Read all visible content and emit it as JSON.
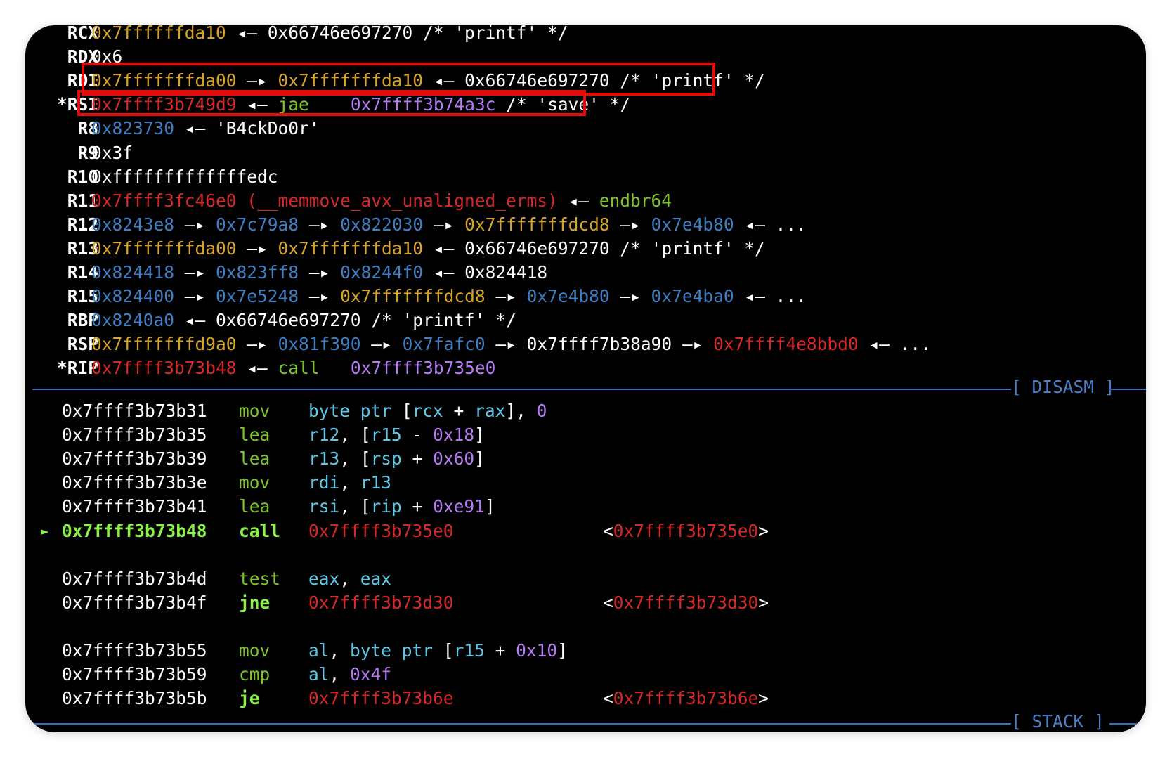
{
  "registers": [
    {
      "name": "RCX",
      "tokens": [
        {
          "t": "0x7ffffffda10",
          "c": "y"
        },
        {
          "t": " ◂— ",
          "c": "w"
        },
        {
          "t": "0x66746e697270 /* 'printf' */",
          "c": "w"
        }
      ]
    },
    {
      "name": "RDX",
      "tokens": [
        {
          "t": "0x6",
          "c": "w"
        }
      ]
    },
    {
      "name": "RDI",
      "tokens": [
        {
          "t": "0x7fffffffda00",
          "c": "y"
        },
        {
          "t": " —▸ ",
          "c": "w"
        },
        {
          "t": "0x7fffffffda10",
          "c": "y"
        },
        {
          "t": " ◂— ",
          "c": "w"
        },
        {
          "t": "0x66746e697270 /* 'printf' */",
          "c": "w"
        }
      ]
    },
    {
      "name": "*RSI",
      "tokens": [
        {
          "t": "0x7ffff3b749d9",
          "c": "r"
        },
        {
          "t": " ◂— ",
          "c": "w"
        },
        {
          "t": "jae",
          "c": "g"
        },
        {
          "t": "    ",
          "c": "w"
        },
        {
          "t": "0x7ffff3b74a3c",
          "c": "p"
        },
        {
          "t": " /* 'save' */",
          "c": "w"
        }
      ]
    },
    {
      "name": "R8",
      "tokens": [
        {
          "t": "0x823730",
          "c": "b"
        },
        {
          "t": " ◂— ",
          "c": "w"
        },
        {
          "t": "'B4ckDo0r'",
          "c": "w"
        }
      ]
    },
    {
      "name": "R9",
      "tokens": [
        {
          "t": "0x3f",
          "c": "w"
        }
      ]
    },
    {
      "name": "R10",
      "tokens": [
        {
          "t": "0xfffffffffffffedc",
          "c": "w"
        }
      ]
    },
    {
      "name": "R11",
      "tokens": [
        {
          "t": "0x7ffff3fc46e0 (__memmove_avx_unaligned_erms)",
          "c": "r"
        },
        {
          "t": " ◂— ",
          "c": "w"
        },
        {
          "t": "endbr64",
          "c": "g"
        }
      ]
    },
    {
      "name": "R12",
      "tokens": [
        {
          "t": "0x8243e8",
          "c": "b"
        },
        {
          "t": " —▸ ",
          "c": "w"
        },
        {
          "t": "0x7c79a8",
          "c": "b"
        },
        {
          "t": " —▸ ",
          "c": "w"
        },
        {
          "t": "0x822030",
          "c": "b"
        },
        {
          "t": " —▸ ",
          "c": "w"
        },
        {
          "t": "0x7fffffffdcd8",
          "c": "y"
        },
        {
          "t": " —▸ ",
          "c": "w"
        },
        {
          "t": "0x7e4b80",
          "c": "b"
        },
        {
          "t": " ◂— ...",
          "c": "w"
        }
      ]
    },
    {
      "name": "R13",
      "tokens": [
        {
          "t": "0x7fffffffda00",
          "c": "y"
        },
        {
          "t": " —▸ ",
          "c": "w"
        },
        {
          "t": "0x7fffffffda10",
          "c": "y"
        },
        {
          "t": " ◂— ",
          "c": "w"
        },
        {
          "t": "0x66746e697270 /* 'printf' */",
          "c": "w"
        }
      ]
    },
    {
      "name": "R14",
      "tokens": [
        {
          "t": "0x824418",
          "c": "b"
        },
        {
          "t": " —▸ ",
          "c": "w"
        },
        {
          "t": "0x823ff8",
          "c": "b"
        },
        {
          "t": " —▸ ",
          "c": "w"
        },
        {
          "t": "0x8244f0",
          "c": "b"
        },
        {
          "t": " ◂— ",
          "c": "w"
        },
        {
          "t": "0x824418",
          "c": "w"
        }
      ]
    },
    {
      "name": "R15",
      "tokens": [
        {
          "t": "0x824400",
          "c": "b"
        },
        {
          "t": " —▸ ",
          "c": "w"
        },
        {
          "t": "0x7e5248",
          "c": "b"
        },
        {
          "t": " —▸ ",
          "c": "w"
        },
        {
          "t": "0x7fffffffdcd8",
          "c": "y"
        },
        {
          "t": " —▸ ",
          "c": "w"
        },
        {
          "t": "0x7e4b80",
          "c": "b"
        },
        {
          "t": " —▸ ",
          "c": "w"
        },
        {
          "t": "0x7e4ba0",
          "c": "b"
        },
        {
          "t": " ◂— ...",
          "c": "w"
        }
      ]
    },
    {
      "name": "RBP",
      "tokens": [
        {
          "t": "0x8240a0",
          "c": "b"
        },
        {
          "t": " ◂— ",
          "c": "w"
        },
        {
          "t": "0x66746e697270 /* 'printf' */",
          "c": "w"
        }
      ]
    },
    {
      "name": "RSP",
      "tokens": [
        {
          "t": "0x7fffffffd9a0",
          "c": "y"
        },
        {
          "t": " —▸ ",
          "c": "w"
        },
        {
          "t": "0x81f390",
          "c": "b"
        },
        {
          "t": " —▸ ",
          "c": "w"
        },
        {
          "t": "0x7fafc0",
          "c": "b"
        },
        {
          "t": " —▸ ",
          "c": "w"
        },
        {
          "t": "0x7ffff7b38a90",
          "c": "w"
        },
        {
          "t": " —▸ ",
          "c": "w"
        },
        {
          "t": "0x7ffff4e8bbd0",
          "c": "r"
        },
        {
          "t": " ◂— ...",
          "c": "w"
        }
      ]
    },
    {
      "name": "*RIP",
      "tokens": [
        {
          "t": "0x7ffff3b73b48",
          "c": "r"
        },
        {
          "t": " ◂— ",
          "c": "w"
        },
        {
          "t": "call",
          "c": "g"
        },
        {
          "t": "   ",
          "c": "w"
        },
        {
          "t": "0x7ffff3b735e0",
          "c": "p"
        }
      ]
    }
  ],
  "disasm_label": "[ DISASM ]",
  "stack_label": "[ STACK ]",
  "current_marker": "►",
  "disasm": [
    {
      "addr": "0x7ffff3b73b31",
      "op": "mov",
      "ops": [
        {
          "t": "byte ptr",
          "c": "c"
        },
        {
          "t": " [",
          "c": "w"
        },
        {
          "t": "rcx",
          "c": "c"
        },
        {
          "t": " + ",
          "c": "w"
        },
        {
          "t": "rax",
          "c": "c"
        },
        {
          "t": "], ",
          "c": "w"
        },
        {
          "t": "0",
          "c": "p"
        }
      ],
      "target": "",
      "gap_after": false,
      "current": false
    },
    {
      "addr": "0x7ffff3b73b35",
      "op": "lea",
      "ops": [
        {
          "t": "r12",
          "c": "c"
        },
        {
          "t": ", [",
          "c": "w"
        },
        {
          "t": "r15",
          "c": "c"
        },
        {
          "t": " - ",
          "c": "w"
        },
        {
          "t": "0x18",
          "c": "p"
        },
        {
          "t": "]",
          "c": "w"
        }
      ],
      "target": "",
      "gap_after": false,
      "current": false
    },
    {
      "addr": "0x7ffff3b73b39",
      "op": "lea",
      "ops": [
        {
          "t": "r13",
          "c": "c"
        },
        {
          "t": ", [",
          "c": "w"
        },
        {
          "t": "rsp",
          "c": "c"
        },
        {
          "t": " + ",
          "c": "w"
        },
        {
          "t": "0x60",
          "c": "p"
        },
        {
          "t": "]",
          "c": "w"
        }
      ],
      "target": "",
      "gap_after": false,
      "current": false
    },
    {
      "addr": "0x7ffff3b73b3e",
      "op": "mov",
      "ops": [
        {
          "t": "rdi",
          "c": "c"
        },
        {
          "t": ", ",
          "c": "w"
        },
        {
          "t": "r13",
          "c": "c"
        }
      ],
      "target": "",
      "gap_after": false,
      "current": false
    },
    {
      "addr": "0x7ffff3b73b41",
      "op": "lea",
      "ops": [
        {
          "t": "rsi",
          "c": "c"
        },
        {
          "t": ", [",
          "c": "w"
        },
        {
          "t": "rip",
          "c": "c"
        },
        {
          "t": " + ",
          "c": "w"
        },
        {
          "t": "0xe91",
          "c": "p"
        },
        {
          "t": "]",
          "c": "w"
        }
      ],
      "target": "",
      "gap_after": false,
      "current": false
    },
    {
      "addr": "0x7ffff3b73b48",
      "op": "call",
      "ops": [
        {
          "t": "0x7ffff3b735e0",
          "c": "r"
        }
      ],
      "target": "0x7ffff3b735e0",
      "gap_after": true,
      "current": true
    },
    {
      "addr": "0x7ffff3b73b4d",
      "op": "test",
      "ops": [
        {
          "t": "eax",
          "c": "c"
        },
        {
          "t": ", ",
          "c": "w"
        },
        {
          "t": "eax",
          "c": "c"
        }
      ],
      "target": "",
      "gap_after": false,
      "current": false
    },
    {
      "addr": "0x7ffff3b73b4f",
      "op": "jne",
      "ops": [
        {
          "t": "0x7ffff3b73d30",
          "c": "r"
        }
      ],
      "target": "0x7ffff3b73d30",
      "gap_after": true,
      "current": false
    },
    {
      "addr": "0x7ffff3b73b55",
      "op": "mov",
      "ops": [
        {
          "t": "al",
          "c": "c"
        },
        {
          "t": ", ",
          "c": "w"
        },
        {
          "t": "byte ptr",
          "c": "c"
        },
        {
          "t": " [",
          "c": "w"
        },
        {
          "t": "r15",
          "c": "c"
        },
        {
          "t": " + ",
          "c": "w"
        },
        {
          "t": "0x10",
          "c": "p"
        },
        {
          "t": "]",
          "c": "w"
        }
      ],
      "target": "",
      "gap_after": false,
      "current": false
    },
    {
      "addr": "0x7ffff3b73b59",
      "op": "cmp",
      "ops": [
        {
          "t": "al",
          "c": "c"
        },
        {
          "t": ", ",
          "c": "w"
        },
        {
          "t": "0x4f",
          "c": "p"
        }
      ],
      "target": "",
      "gap_after": false,
      "current": false
    },
    {
      "addr": "0x7ffff3b73b5b",
      "op": "je",
      "ops": [
        {
          "t": "0x7ffff3b73b6e",
          "c": "r"
        }
      ],
      "target": "0x7ffff3b73b6e",
      "gap_after": false,
      "current": false
    }
  ],
  "colors": {
    "highlight_box": "#e40b0b",
    "separator": "#2f6fd0"
  }
}
